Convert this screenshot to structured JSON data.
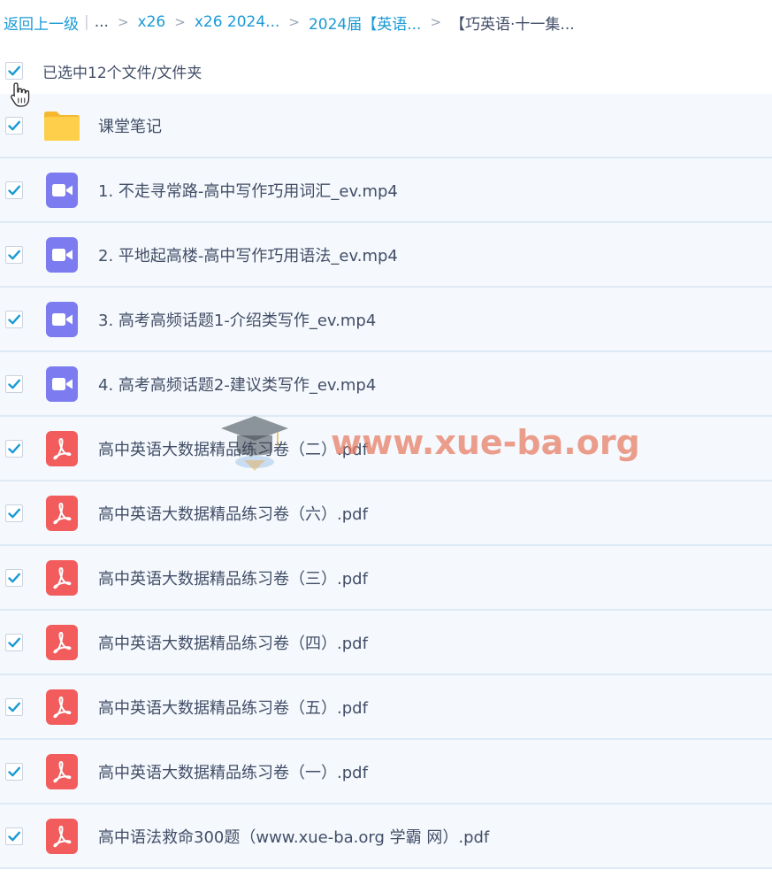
{
  "breadcrumb": {
    "back": "返回上一级",
    "separator": "|",
    "ellipsis": "...",
    "arrow": ">",
    "items": [
      "x26",
      "x26 2024...",
      "2024届【英语..."
    ],
    "current": "【巧英语·十一集..."
  },
  "selection": {
    "label": "已选中12个文件/文件夹",
    "all_checked": true
  },
  "files": [
    {
      "name": "课堂笔记",
      "type": "folder-icon",
      "checked": true
    },
    {
      "name": "1. 不走寻常路-高中写作巧用词汇_ev.mp4",
      "type": "video-icon",
      "checked": true
    },
    {
      "name": "2. 平地起高楼-高中写作巧用语法_ev.mp4",
      "type": "video-icon",
      "checked": true
    },
    {
      "name": "3. 高考高频话题1-介绍类写作_ev.mp4",
      "type": "video-icon",
      "checked": true
    },
    {
      "name": "4. 高考高频话题2-建议类写作_ev.mp4",
      "type": "video-icon",
      "checked": true
    },
    {
      "name": "高中英语大数据精品练习卷（二）.pdf",
      "type": "pdf-icon",
      "checked": true
    },
    {
      "name": "高中英语大数据精品练习卷（六）.pdf",
      "type": "pdf-icon",
      "checked": true
    },
    {
      "name": "高中英语大数据精品练习卷（三）.pdf",
      "type": "pdf-icon",
      "checked": true
    },
    {
      "name": "高中英语大数据精品练习卷（四）.pdf",
      "type": "pdf-icon",
      "checked": true
    },
    {
      "name": "高中英语大数据精品练习卷（五）.pdf",
      "type": "pdf-icon",
      "checked": true
    },
    {
      "name": "高中英语大数据精品练习卷（一）.pdf",
      "type": "pdf-icon",
      "checked": true
    },
    {
      "name": "高中语法救命300题（www.xue-ba.org 学霸 网）.pdf",
      "type": "pdf-icon",
      "checked": true
    }
  ],
  "watermark": {
    "text": "www.xue-ba.org"
  },
  "colors": {
    "link": "#1a9ad6",
    "check": "#1a9ad6",
    "folder": "#fdcf4a",
    "video": "#7c7cf0",
    "pdf": "#f25c5c",
    "row_bg": "#f5f9fd",
    "row_border": "#dde9f5"
  }
}
